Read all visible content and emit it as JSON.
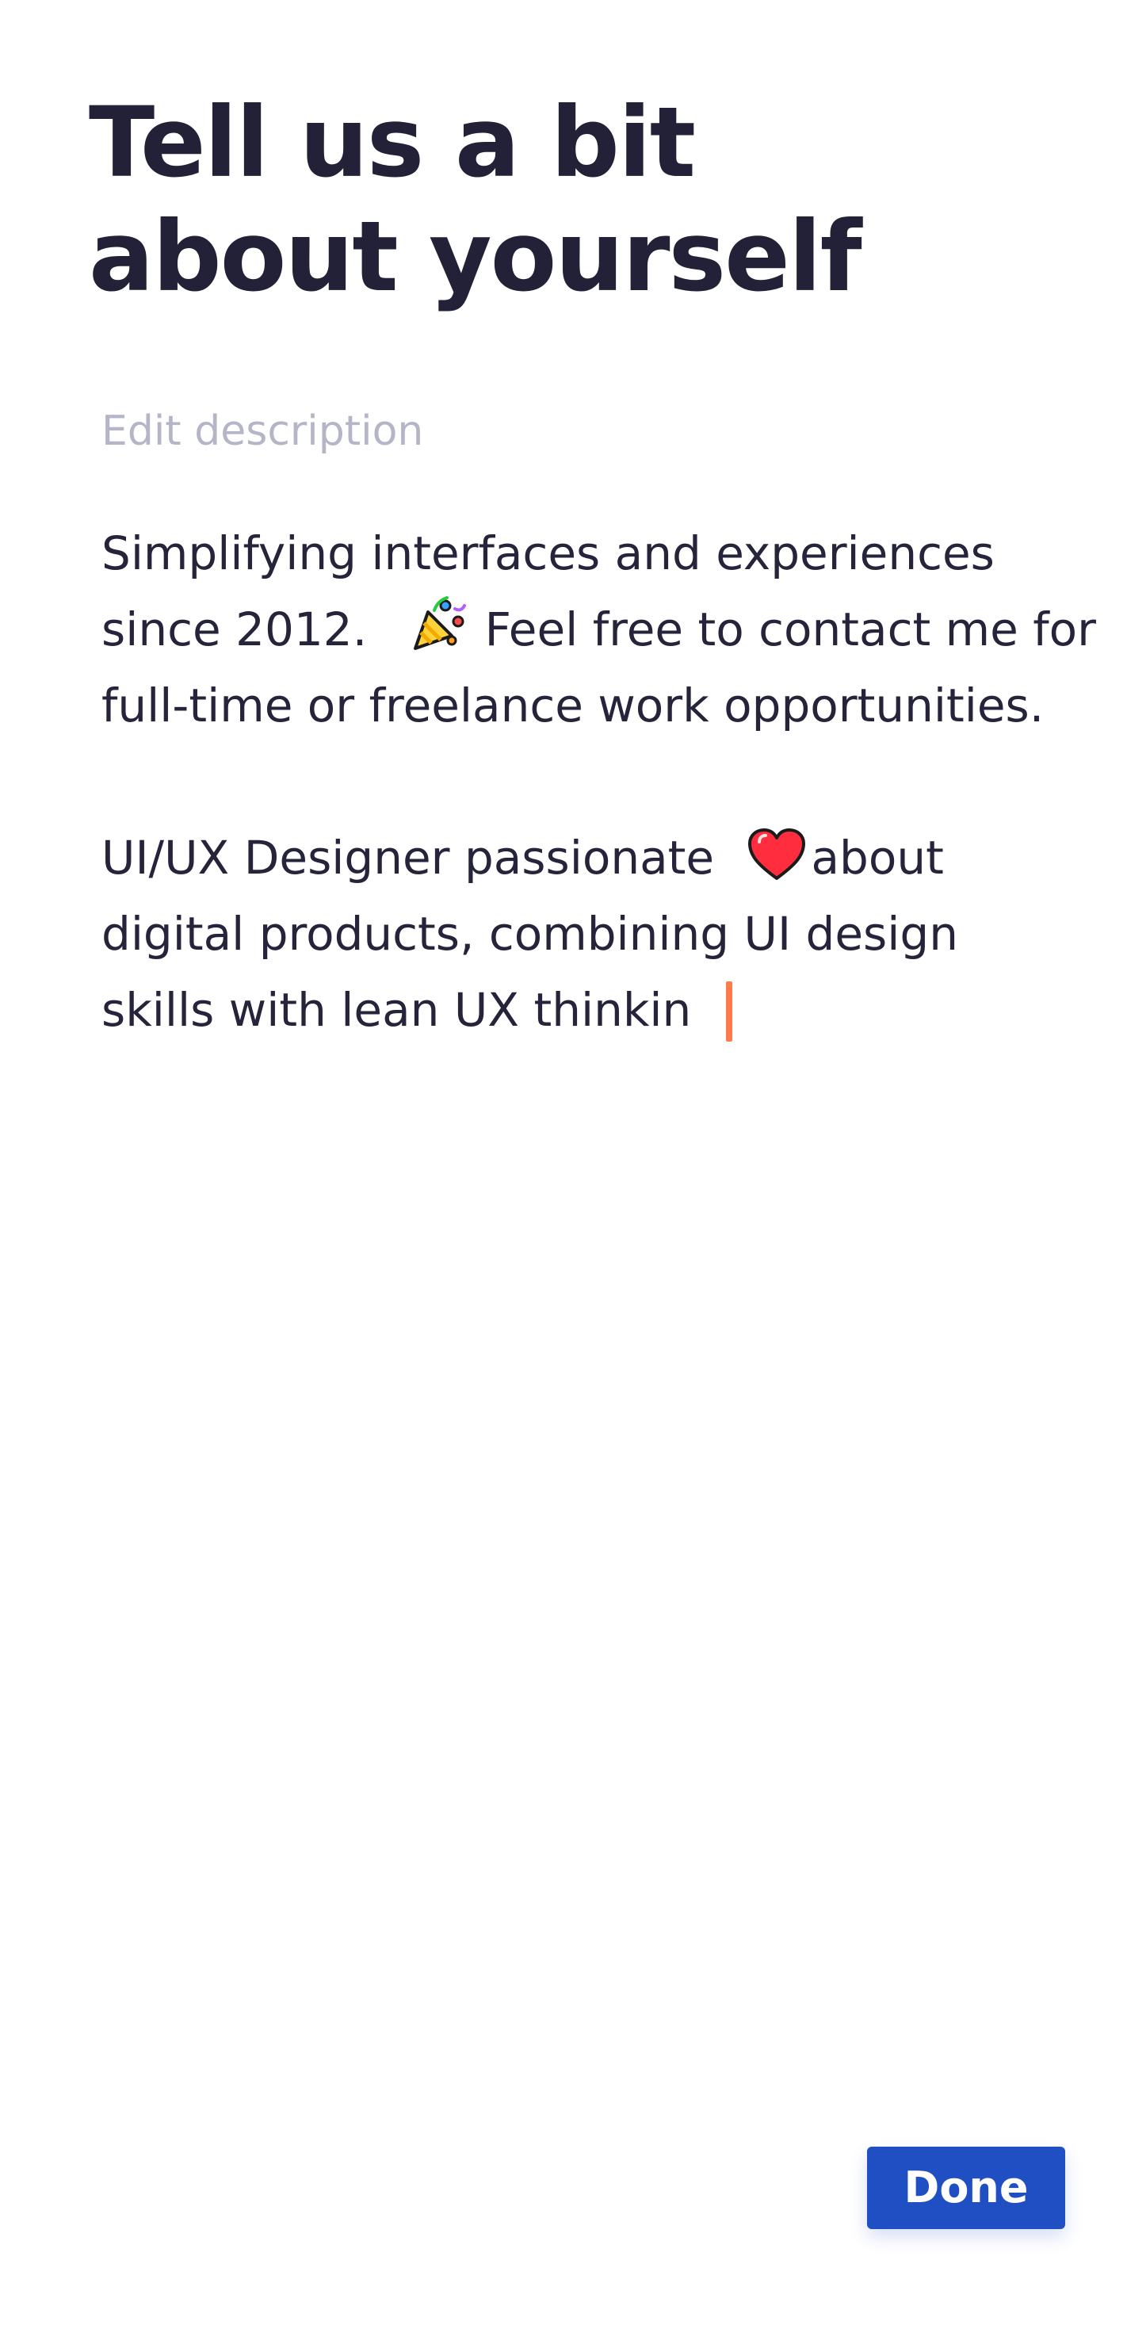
{
  "header": {
    "title_line1": "Tell us a bit",
    "title_line2": "about yourself"
  },
  "form": {
    "field_label": "Edit description",
    "paragraph1": {
      "line1": "Simplifying interfaces and experiences",
      "line2_before_emoji": "since 2012.",
      "line2_after_emoji": "Feel free to contact me for",
      "line3": "full-time or freelance work opportunities.",
      "emoji_icon": "party-popper-icon"
    },
    "paragraph2": {
      "line1_before_emoji": "UI/UX Designer passionate",
      "line1_after_emoji": "about",
      "line2": "digital products, combining UI design",
      "line3": "skills with lean UX thinkin",
      "emoji_icon": "red-heart-icon"
    }
  },
  "actions": {
    "done_label": "Done"
  },
  "colors": {
    "title": "#222138",
    "body_text": "#25243a",
    "label": "#b4b6c7",
    "caret": "#ff7a4d",
    "button_bg": "#1f4fc3",
    "button_text": "#ffffff"
  }
}
